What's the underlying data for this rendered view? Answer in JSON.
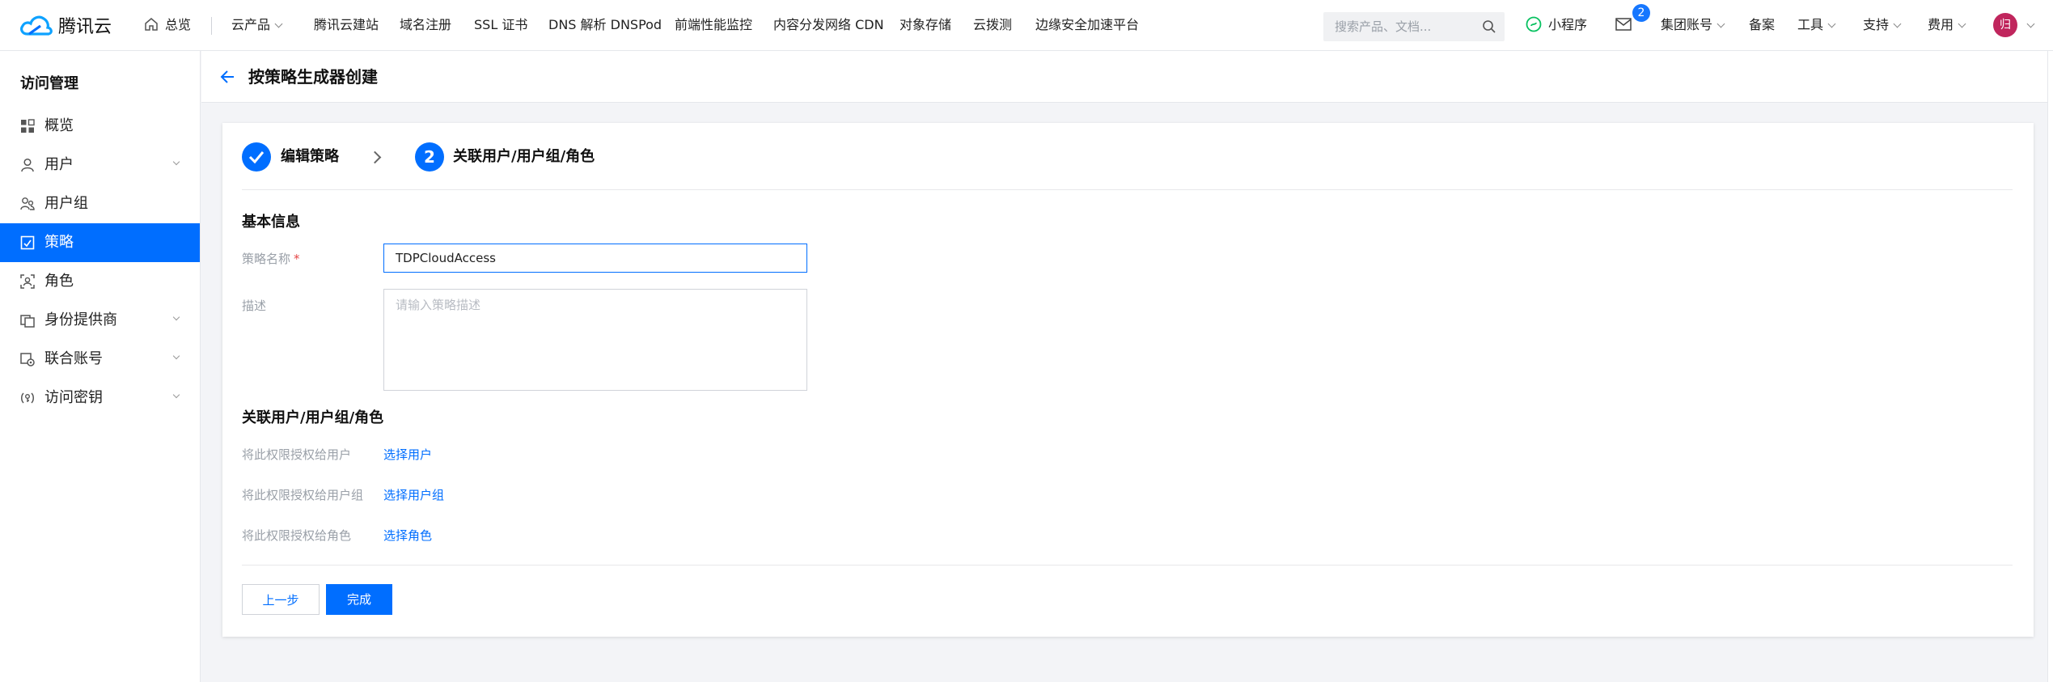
{
  "topnav": {
    "logo_text": "腾讯云",
    "overview": "总览",
    "products": "云产品",
    "links": [
      "腾讯云建站",
      "域名注册",
      "SSL 证书",
      "DNS 解析 DNSPod",
      "前端性能监控",
      "内容分发网络 CDN",
      "对象存储",
      "云拨测",
      "边缘安全加速平台"
    ],
    "search_placeholder": "搜索产品、文档...",
    "miniprogram": "小程序",
    "message_count": "2",
    "group_account": "集团账号",
    "filing": "备案",
    "tools": "工具",
    "support": "支持",
    "billing": "费用",
    "avatar_text": "归"
  },
  "sidebar": {
    "title": "访问管理",
    "items": [
      {
        "label": "概览",
        "icon": "grid-icon",
        "expandable": false
      },
      {
        "label": "用户",
        "icon": "user-icon",
        "expandable": true
      },
      {
        "label": "用户组",
        "icon": "user-group-icon",
        "expandable": false
      },
      {
        "label": "策略",
        "icon": "policy-icon",
        "expandable": false,
        "active": true
      },
      {
        "label": "角色",
        "icon": "role-icon",
        "expandable": false
      },
      {
        "label": "身份提供商",
        "icon": "identity-provider-icon",
        "expandable": true
      },
      {
        "label": "联合账号",
        "icon": "federated-account-icon",
        "expandable": true
      },
      {
        "label": "访问密钥",
        "icon": "access-key-icon",
        "expandable": true
      }
    ]
  },
  "page": {
    "title": "按策略生成器创建"
  },
  "steps": [
    {
      "label": "编辑策略",
      "status": "done"
    },
    {
      "number": "2",
      "label": "关联用户/用户组/角色",
      "status": "current"
    }
  ],
  "form": {
    "basic_info_title": "基本信息",
    "policy_name_label": "策略名称",
    "required_mark": "*",
    "policy_name_value": "TDPCloudAccess",
    "description_label": "描述",
    "description_placeholder": "请输入策略描述",
    "associate_title": "关联用户/用户组/角色",
    "grant_user_label": "将此权限授权给用户",
    "grant_user_link": "选择用户",
    "grant_group_label": "将此权限授权给用户组",
    "grant_group_link": "选择用户组",
    "grant_role_label": "将此权限授权给角色",
    "grant_role_link": "选择角色"
  },
  "buttons": {
    "prev": "上一步",
    "done": "完成"
  },
  "colors": {
    "primary": "#006eff",
    "required": "#e54545",
    "avatar": "#c0265d"
  }
}
